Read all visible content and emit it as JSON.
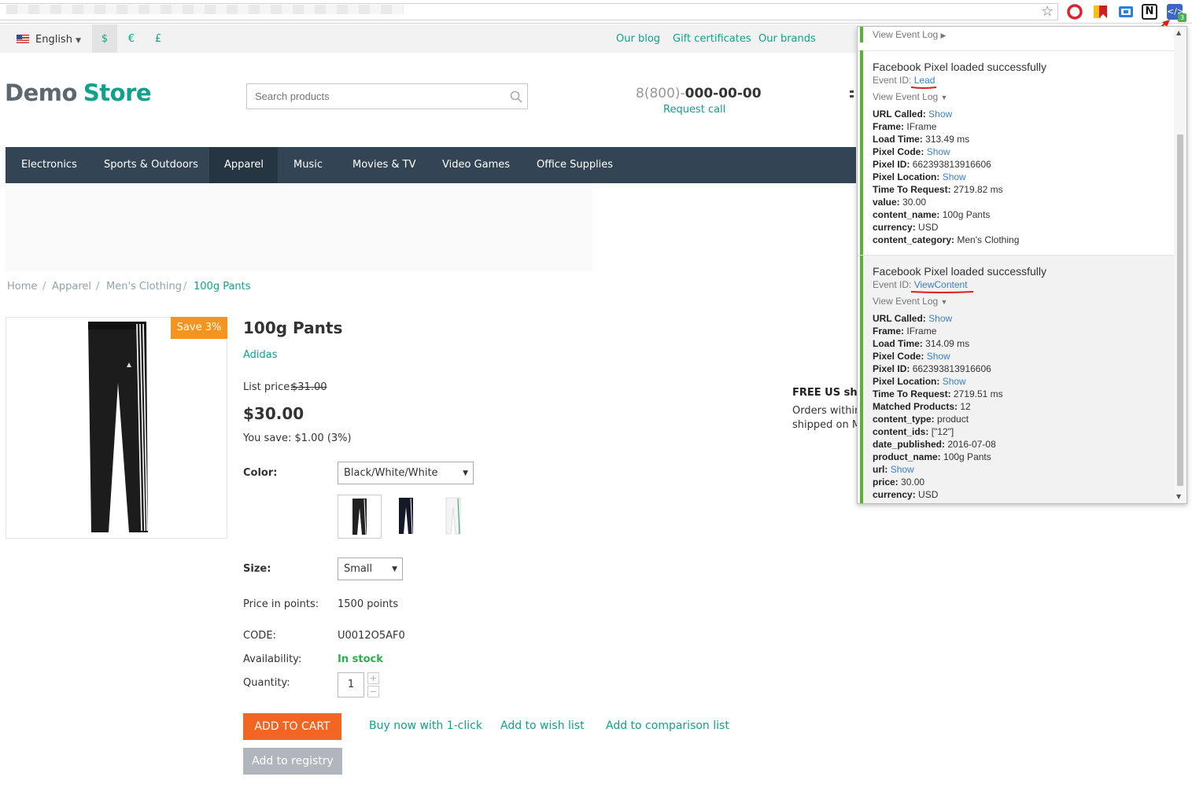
{
  "toolbar": {
    "ext_badge": "3",
    "icons": [
      "star-icon",
      "opera-icon",
      "bookmark-flag-icon",
      "cast-icon",
      "notes-icon",
      "pixel-helper-icon"
    ]
  },
  "topbar": {
    "language": "English",
    "currencies": [
      "$",
      "€",
      "£"
    ],
    "links": [
      "Our blog",
      "Gift certificates",
      "Our brands"
    ]
  },
  "header": {
    "logo_part1": "Demo",
    "logo_part2": "Store",
    "search_placeholder": "Search products",
    "phone_prefix": "8(800)-",
    "phone_main": "000-00-00",
    "request_call": "Request call"
  },
  "nav": [
    "Electronics",
    "Sports & Outdoors",
    "Apparel",
    "Music",
    "Movies & TV",
    "Video Games",
    "Office Supplies"
  ],
  "breadcrumb": [
    "Home",
    "Apparel",
    "Men's Clothing",
    "100g Pants"
  ],
  "breadcrumb_sep": "/",
  "product": {
    "badge": "Save 3%",
    "title": "100g Pants",
    "brand": "Adidas",
    "list_price_label": "List price:",
    "list_price": "$31.00",
    "price": "$30.00",
    "you_save": "You save: $1.00 (3%)",
    "color_label": "Color:",
    "color_value": "Black/White/White",
    "size_label": "Size:",
    "size_value": "Small",
    "points_label": "Price in points:",
    "points_value": "1500 points",
    "code_label": "CODE:",
    "code_value": "U0012O5AF0",
    "availability_label": "Availability:",
    "availability_value": "In stock",
    "quantity_label": "Quantity:",
    "quantity_value": "1",
    "add_to_cart": "ADD TO CART",
    "buy_now": "Buy now with 1-click",
    "wishlist": "Add to wish list",
    "comparison": "Add to comparison list",
    "registry": "Add to registry"
  },
  "shipping": {
    "title": "FREE US ship",
    "line1": "Orders within",
    "line2": "shipped on M"
  },
  "pixel_panel": {
    "top_view_log": "View Event Log",
    "events": [
      {
        "title": "Facebook Pixel loaded successfully",
        "event_id_label": "Event ID:",
        "event_id": "Lead",
        "view_log": "View Event Log",
        "fields": [
          {
            "k": "URL Called:",
            "v": "Show",
            "link": true
          },
          {
            "k": "Frame:",
            "v": "IFrame"
          },
          {
            "k": "Load Time:",
            "v": "313.49 ms"
          },
          {
            "k": "Pixel Code:",
            "v": "Show",
            "link": true
          },
          {
            "k": "Pixel ID:",
            "v": "662393813916606"
          },
          {
            "k": "Pixel Location:",
            "v": "Show",
            "link": true
          },
          {
            "k": "Time To Request:",
            "v": "2719.82 ms"
          },
          {
            "k": "value:",
            "v": "30.00"
          },
          {
            "k": "content_name:",
            "v": "100g Pants"
          },
          {
            "k": "currency:",
            "v": "USD"
          },
          {
            "k": "content_category:",
            "v": "Men's Clothing"
          }
        ]
      },
      {
        "title": "Facebook Pixel loaded successfully",
        "event_id_label": "Event ID:",
        "event_id": "ViewContent",
        "view_log": "View Event Log",
        "fields": [
          {
            "k": "URL Called:",
            "v": "Show",
            "link": true
          },
          {
            "k": "Frame:",
            "v": "IFrame"
          },
          {
            "k": "Load Time:",
            "v": "314.09 ms"
          },
          {
            "k": "Pixel Code:",
            "v": "Show",
            "link": true
          },
          {
            "k": "Pixel ID:",
            "v": "662393813916606"
          },
          {
            "k": "Pixel Location:",
            "v": "Show",
            "link": true
          },
          {
            "k": "Time To Request:",
            "v": "2719.51 ms"
          },
          {
            "k": "Matched Products:",
            "v": "12"
          },
          {
            "k": "content_type:",
            "v": "product"
          },
          {
            "k": "content_ids:",
            "v": "[\"12\"]"
          },
          {
            "k": "date_published:",
            "v": "2016-07-08"
          },
          {
            "k": "product_name:",
            "v": "100g Pants"
          },
          {
            "k": "url:",
            "v": "Show",
            "link": true
          },
          {
            "k": "price:",
            "v": "30.00"
          },
          {
            "k": "currency:",
            "v": "USD"
          }
        ]
      }
    ]
  },
  "colors": {
    "accent": "#11a18a",
    "nav_bg": "#334554",
    "cart_btn": "#f26522",
    "badge": "#f7941d",
    "in_stock": "#2ab04a",
    "pixel_green": "#5ab234"
  }
}
